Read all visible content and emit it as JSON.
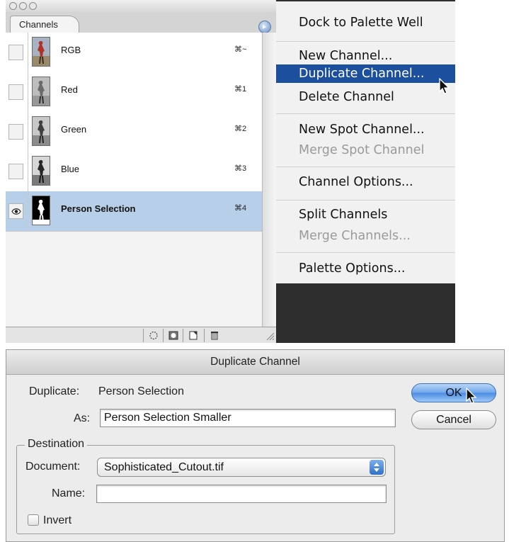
{
  "channels_palette": {
    "tab_label": "Channels",
    "channels": [
      {
        "name": "RGB",
        "shortcut": "⌘~",
        "visible": false,
        "selected": false
      },
      {
        "name": "Red",
        "shortcut": "⌘1",
        "visible": false,
        "selected": false
      },
      {
        "name": "Green",
        "shortcut": "⌘2",
        "visible": false,
        "selected": false
      },
      {
        "name": "Blue",
        "shortcut": "⌘3",
        "visible": false,
        "selected": false
      },
      {
        "name": "Person Selection",
        "shortcut": "⌘4",
        "visible": true,
        "selected": true
      }
    ],
    "bottom_icons": [
      "load-selection-icon",
      "save-selection-icon",
      "new-channel-icon",
      "trash-icon"
    ]
  },
  "palette_menu": {
    "items": [
      {
        "label": "Dock to Palette Well",
        "enabled": true,
        "highlighted": false
      },
      {
        "label": "New Channel...",
        "enabled": true,
        "highlighted": false
      },
      {
        "label": "Duplicate Channel...",
        "enabled": true,
        "highlighted": true
      },
      {
        "label": "Delete Channel",
        "enabled": true,
        "highlighted": false
      },
      {
        "label": "New Spot Channel...",
        "enabled": true,
        "highlighted": false
      },
      {
        "label": "Merge Spot Channel",
        "enabled": false,
        "highlighted": false
      },
      {
        "label": "Channel Options...",
        "enabled": true,
        "highlighted": false
      },
      {
        "label": "Split Channels",
        "enabled": true,
        "highlighted": false
      },
      {
        "label": "Merge Channels...",
        "enabled": false,
        "highlighted": false
      },
      {
        "label": "Palette Options...",
        "enabled": true,
        "highlighted": false
      }
    ]
  },
  "dialog": {
    "title": "Duplicate Channel",
    "duplicate_label": "Duplicate:",
    "duplicate_value": "Person Selection",
    "as_label": "As:",
    "as_value": "Person Selection Smaller",
    "destination_label": "Destination",
    "document_label": "Document:",
    "document_value": "Sophisticated_Cutout.tif",
    "name_label": "Name:",
    "name_value": "",
    "invert_label": "Invert",
    "invert_checked": false,
    "ok_label": "OK",
    "cancel_label": "Cancel"
  },
  "colors": {
    "selection_row": "#b7cfe8",
    "menu_highlight": "#1c4f9e",
    "ok_button": "#6ea6ea"
  }
}
